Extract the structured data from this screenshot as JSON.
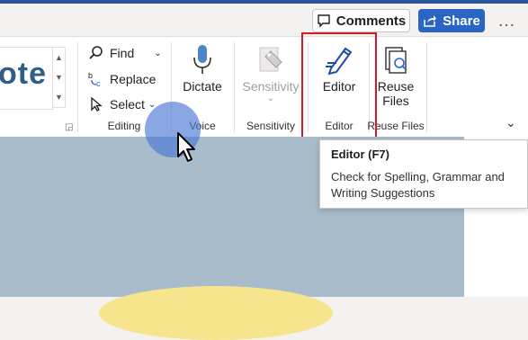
{
  "header": {
    "comments_label": "Comments",
    "share_label": "Share"
  },
  "ribbon": {
    "styles_preview": "ote",
    "editing": {
      "find_label": "Find",
      "replace_label": "Replace",
      "select_label": "Select",
      "group_label": "Editing"
    },
    "voice": {
      "dictate_label": "Dictate",
      "group_label": "Voice"
    },
    "sensitivity": {
      "button_label": "Sensitivity",
      "group_label": "Sensitivity"
    },
    "editor": {
      "button_label": "Editor",
      "group_label": "Editor"
    },
    "reuse_files": {
      "button_label_line1": "Reuse",
      "button_label_line2": "Files",
      "group_label": "Reuse Files"
    }
  },
  "tooltip": {
    "title": "Editor (F7)",
    "description_line1": "Check for Spelling, Grammar and",
    "description_line2": "Writing Suggestions"
  },
  "colors": {
    "accent": "#2b579a",
    "share_button": "#2b65c4",
    "highlight_box": "#d11a2a",
    "click_indicator": "#4a78d6"
  }
}
